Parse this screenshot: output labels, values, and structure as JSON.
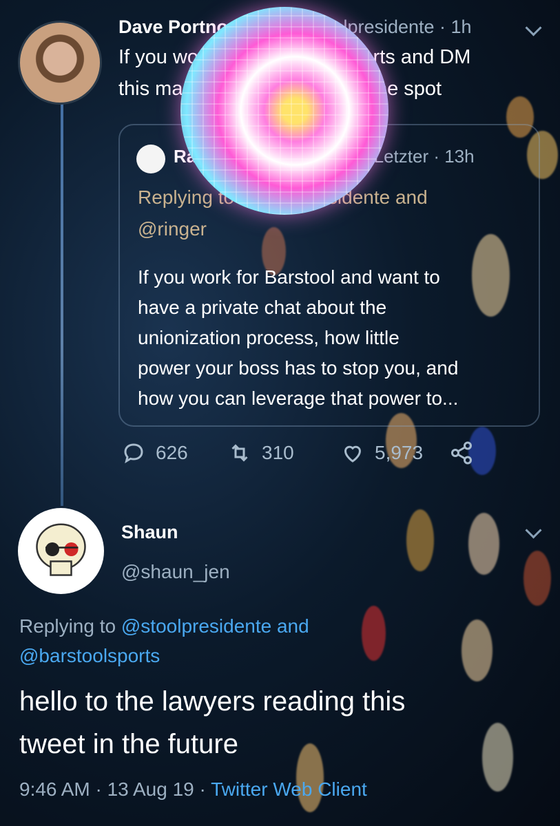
{
  "tweet1": {
    "author": "Dave Portnoy",
    "handle_time": "@stoolpresidente · 1h",
    "line1a": "If you work for @barstoolsports",
    "line1b": " and DM",
    "line2": "this man you will be fired on the spot"
  },
  "quoted": {
    "author": "Ramsey",
    "handle_time": "@RafiLetzter · 13h",
    "reply_prefix": "Replying to",
    "reply_targets": "@stoolpresidente and",
    "reply_targets2": "@ringer",
    "lines": [
      "If you work for Barstool and want to",
      "have a private chat about the",
      "unionization process, how little",
      "power your boss has to stop you, and",
      "how you can leverage that power to..."
    ]
  },
  "actions": {
    "replies": "626",
    "retweets": "310",
    "likes": "5,973"
  },
  "tweet2": {
    "author": "Shaun",
    "handle": "@shaun_jen",
    "reply_prefix": "Replying to",
    "reply_targets": "@stoolpresidente and",
    "reply_targets2": "@barstoolsports",
    "text_line1": "hello to the lawyers reading this",
    "text_line2": "tweet in the future",
    "timestamp": "9:46 AM · 13 Aug 19 · ",
    "client": "Twitter Web Client"
  },
  "icons": [
    "reply-icon",
    "retweet-icon",
    "like-icon",
    "share-icon",
    "chevron-down-icon"
  ],
  "colors": {
    "link": "#4aa8f0",
    "muted": "#9db0c2",
    "text": "#ffffff"
  }
}
